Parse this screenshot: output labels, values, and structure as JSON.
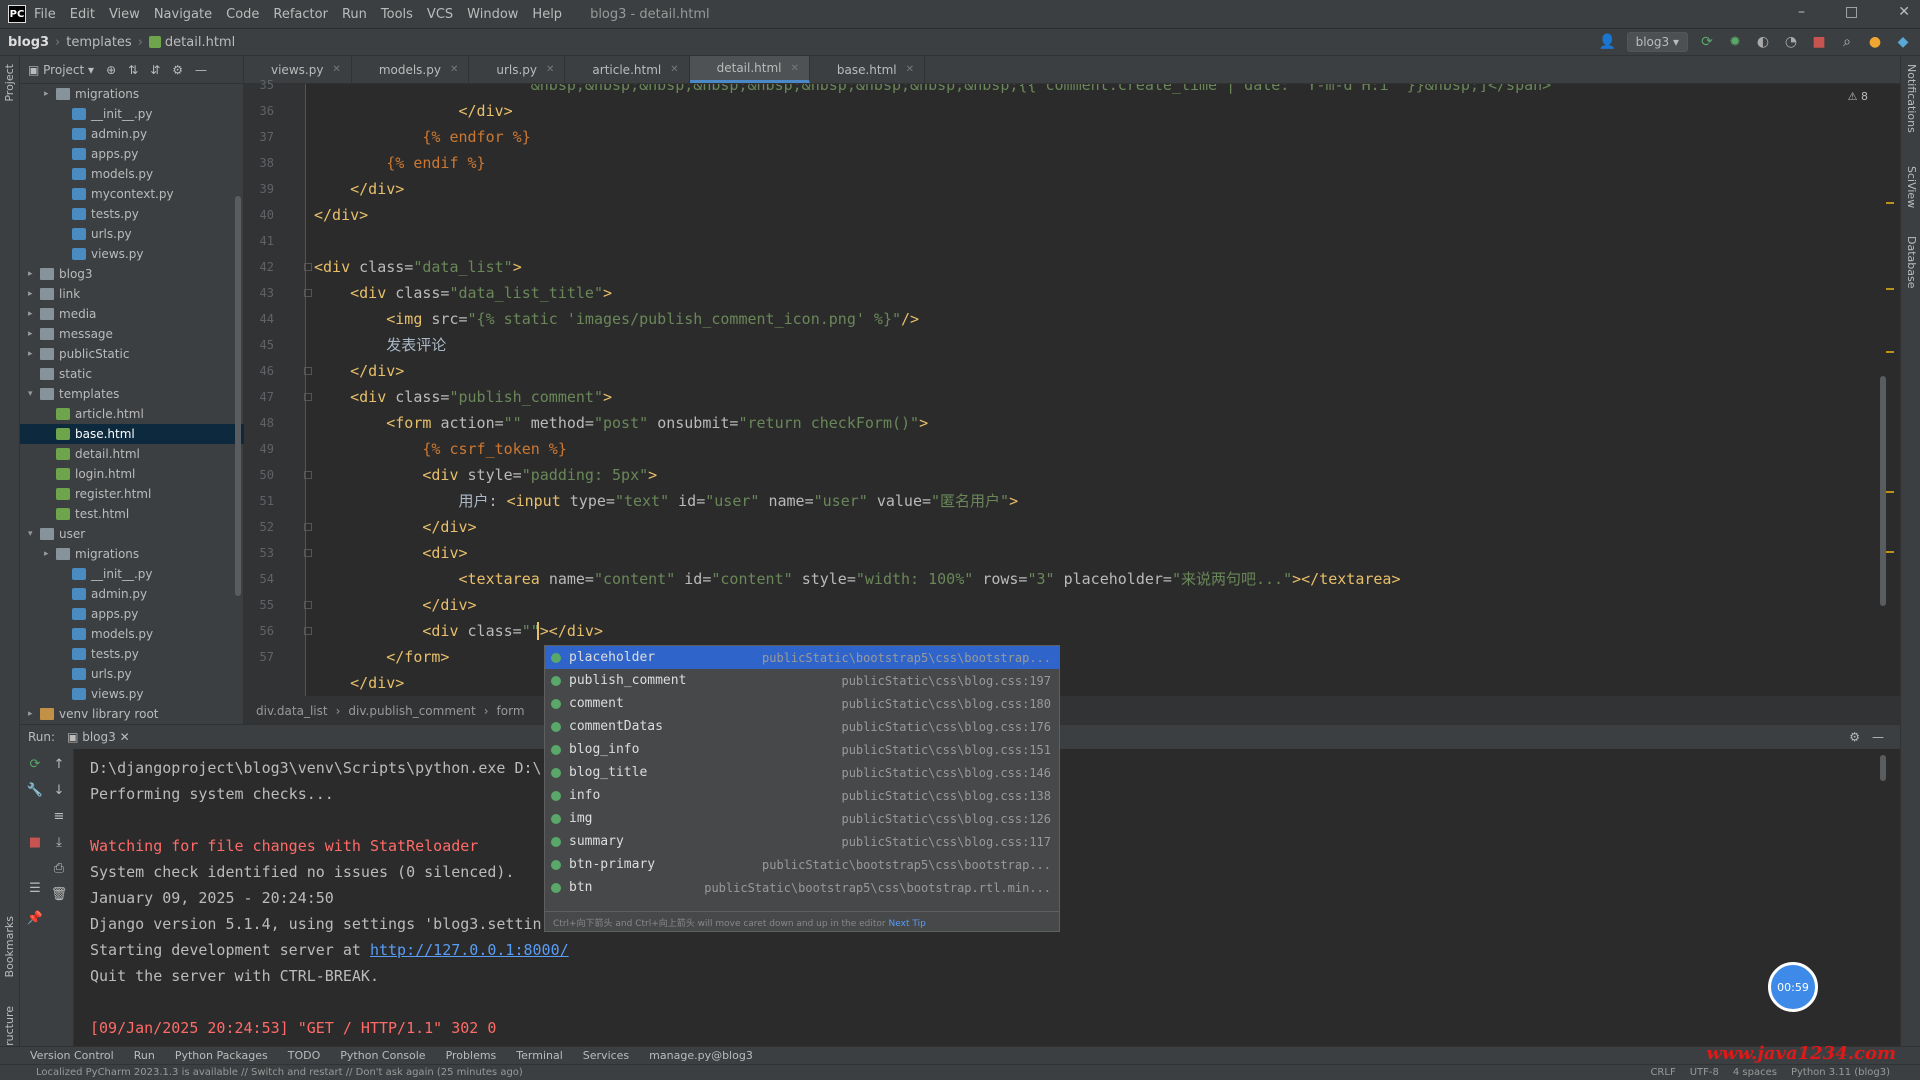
{
  "window": {
    "title": "blog3 - detail.html",
    "menu": [
      "File",
      "Edit",
      "View",
      "Navigate",
      "Code",
      "Refactor",
      "Run",
      "Tools",
      "VCS",
      "Window",
      "Help"
    ],
    "controls": [
      "–",
      "□",
      "✕"
    ]
  },
  "navbar": {
    "crumbs": [
      "blog3",
      "templates",
      "detail.html"
    ],
    "run_config": "blog3"
  },
  "project_panel": {
    "title": "Project",
    "tree": [
      {
        "label": "migrations",
        "type": "folder",
        "depth": 2,
        "arrow": "▸"
      },
      {
        "label": "__init__.py",
        "type": "py",
        "depth": 3
      },
      {
        "label": "admin.py",
        "type": "py",
        "depth": 3
      },
      {
        "label": "apps.py",
        "type": "py",
        "depth": 3
      },
      {
        "label": "models.py",
        "type": "py",
        "depth": 3
      },
      {
        "label": "mycontext.py",
        "type": "py",
        "depth": 3
      },
      {
        "label": "tests.py",
        "type": "py",
        "depth": 3
      },
      {
        "label": "urls.py",
        "type": "py",
        "depth": 3
      },
      {
        "label": "views.py",
        "type": "py",
        "depth": 3
      },
      {
        "label": "blog3",
        "type": "folder",
        "depth": 1,
        "arrow": "▸"
      },
      {
        "label": "link",
        "type": "folder",
        "depth": 1,
        "arrow": "▸"
      },
      {
        "label": "media",
        "type": "folder",
        "depth": 1,
        "arrow": "▸"
      },
      {
        "label": "message",
        "type": "folder",
        "depth": 1,
        "arrow": "▸"
      },
      {
        "label": "publicStatic",
        "type": "folder",
        "depth": 1,
        "arrow": "▸"
      },
      {
        "label": "static",
        "type": "folder",
        "depth": 1
      },
      {
        "label": "templates",
        "type": "folder",
        "depth": 1,
        "arrow": "▾"
      },
      {
        "label": "article.html",
        "type": "html",
        "depth": 2
      },
      {
        "label": "base.html",
        "type": "html",
        "depth": 2,
        "selected": true
      },
      {
        "label": "detail.html",
        "type": "html",
        "depth": 2
      },
      {
        "label": "login.html",
        "type": "html",
        "depth": 2
      },
      {
        "label": "register.html",
        "type": "html",
        "depth": 2
      },
      {
        "label": "test.html",
        "type": "html",
        "depth": 2
      },
      {
        "label": "user",
        "type": "folder",
        "depth": 1,
        "arrow": "▾"
      },
      {
        "label": "migrations",
        "type": "folder",
        "depth": 2,
        "arrow": "▸"
      },
      {
        "label": "__init__.py",
        "type": "py",
        "depth": 3
      },
      {
        "label": "admin.py",
        "type": "py",
        "depth": 3
      },
      {
        "label": "apps.py",
        "type": "py",
        "depth": 3
      },
      {
        "label": "models.py",
        "type": "py",
        "depth": 3
      },
      {
        "label": "tests.py",
        "type": "py",
        "depth": 3
      },
      {
        "label": "urls.py",
        "type": "py",
        "depth": 3
      },
      {
        "label": "views.py",
        "type": "py",
        "depth": 3
      },
      {
        "label": "venv  library root",
        "type": "venv",
        "depth": 1,
        "arrow": "▸"
      }
    ]
  },
  "tabs": [
    {
      "label": "views.py",
      "type": "py"
    },
    {
      "label": "models.py",
      "type": "py"
    },
    {
      "label": "urls.py",
      "type": "py"
    },
    {
      "label": "article.html",
      "type": "html"
    },
    {
      "label": "detail.html",
      "type": "html",
      "active": true
    },
    {
      "label": "base.html",
      "type": "html"
    }
  ],
  "editor": {
    "inspection": "⚠ 8",
    "line_numbers": [
      "35",
      "36",
      "37",
      "38",
      "39",
      "40",
      "41",
      "42",
      "43",
      "44",
      "45",
      "46",
      "47",
      "48",
      "49",
      "50",
      "51",
      "52",
      "53",
      "54",
      "55",
      "56",
      "57"
    ],
    "lines": [
      [
        {
          "t": "                        &nbsp;&nbsp;&nbsp;&nbsp;&nbsp;&nbsp;&nbsp;&nbsp;&nbsp;{{ comment.create_time | date: 'Y-m-d H:i' }}&nbsp;]</span>",
          "c": "str"
        }
      ],
      [
        {
          "t": "                </div>",
          "c": "tag"
        }
      ],
      [
        {
          "t": "            ",
          "c": "txt"
        },
        {
          "t": "{% endfor %}",
          "c": "tpl"
        }
      ],
      [
        {
          "t": "        ",
          "c": "txt"
        },
        {
          "t": "{% endif %}",
          "c": "tpl"
        }
      ],
      [
        {
          "t": "    </div>",
          "c": "tag"
        }
      ],
      [
        {
          "t": "</div>",
          "c": "tag"
        }
      ],
      [
        {
          "t": "",
          "c": "txt"
        }
      ],
      [
        {
          "t": "<div ",
          "c": "tag"
        },
        {
          "t": "class=",
          "c": "atr"
        },
        {
          "t": "\"data_list\"",
          "c": "str"
        },
        {
          "t": ">",
          "c": "tag"
        }
      ],
      [
        {
          "t": "    <div ",
          "c": "tag"
        },
        {
          "t": "class=",
          "c": "atr"
        },
        {
          "t": "\"data_list_title\"",
          "c": "str"
        },
        {
          "t": ">",
          "c": "tag"
        }
      ],
      [
        {
          "t": "        <img ",
          "c": "tag"
        },
        {
          "t": "src=",
          "c": "atr"
        },
        {
          "t": "\"{% static 'images/publish_comment_icon.png' %}\"",
          "c": "str"
        },
        {
          "t": "/>",
          "c": "tag"
        }
      ],
      [
        {
          "t": "        发表评论",
          "c": "txt"
        }
      ],
      [
        {
          "t": "    </div>",
          "c": "tag"
        }
      ],
      [
        {
          "t": "    <div ",
          "c": "tag"
        },
        {
          "t": "class=",
          "c": "atr"
        },
        {
          "t": "\"publish_comment\"",
          "c": "str"
        },
        {
          "t": ">",
          "c": "tag"
        }
      ],
      [
        {
          "t": "        <form ",
          "c": "tag"
        },
        {
          "t": "action=",
          "c": "atr"
        },
        {
          "t": "\"\" ",
          "c": "str"
        },
        {
          "t": "method=",
          "c": "atr"
        },
        {
          "t": "\"post\" ",
          "c": "str"
        },
        {
          "t": "onsubmit=",
          "c": "atr"
        },
        {
          "t": "\"return checkForm()\"",
          "c": "str"
        },
        {
          "t": ">",
          "c": "tag"
        }
      ],
      [
        {
          "t": "            ",
          "c": "txt"
        },
        {
          "t": "{% csrf_token %}",
          "c": "tpl"
        }
      ],
      [
        {
          "t": "            <div ",
          "c": "tag"
        },
        {
          "t": "style=",
          "c": "atr"
        },
        {
          "t": "\"padding: 5px\"",
          "c": "str"
        },
        {
          "t": ">",
          "c": "tag"
        }
      ],
      [
        {
          "t": "                用户: ",
          "c": "txt"
        },
        {
          "t": "<input ",
          "c": "tag"
        },
        {
          "t": "type=",
          "c": "atr"
        },
        {
          "t": "\"text\" ",
          "c": "str"
        },
        {
          "t": "id=",
          "c": "atr"
        },
        {
          "t": "\"user\" ",
          "c": "str"
        },
        {
          "t": "name=",
          "c": "atr"
        },
        {
          "t": "\"user\" ",
          "c": "str"
        },
        {
          "t": "value=",
          "c": "atr"
        },
        {
          "t": "\"匿名用户\"",
          "c": "str"
        },
        {
          "t": ">",
          "c": "tag"
        }
      ],
      [
        {
          "t": "            </div>",
          "c": "tag"
        }
      ],
      [
        {
          "t": "            <div>",
          "c": "tag"
        }
      ],
      [
        {
          "t": "                <textarea ",
          "c": "tag"
        },
        {
          "t": "name=",
          "c": "atr"
        },
        {
          "t": "\"content\" ",
          "c": "str"
        },
        {
          "t": "id=",
          "c": "atr"
        },
        {
          "t": "\"content\" ",
          "c": "str"
        },
        {
          "t": "style=",
          "c": "atr"
        },
        {
          "t": "\"width: 100%\" ",
          "c": "str"
        },
        {
          "t": "rows=",
          "c": "atr"
        },
        {
          "t": "\"3\" ",
          "c": "str"
        },
        {
          "t": "placeholder=",
          "c": "atr"
        },
        {
          "t": "\"来说两句吧...\"",
          "c": "str"
        },
        {
          "t": "></textarea>",
          "c": "tag"
        }
      ],
      [
        {
          "t": "            </div>",
          "c": "tag"
        }
      ],
      [
        {
          "t": "            <div ",
          "c": "tag"
        },
        {
          "t": "class=",
          "c": "atr"
        },
        {
          "t": "\"\"",
          "c": "str"
        },
        {
          "t": "></div>",
          "c": "tag"
        }
      ],
      [
        {
          "t": "        </form>",
          "c": "tag"
        }
      ],
      [
        {
          "t": "    </div>",
          "c": "tag"
        }
      ]
    ],
    "breadcrumb": [
      "div.data_list",
      "div.publish_comment",
      "form"
    ]
  },
  "autocomplete": {
    "items": [
      {
        "name": "placeholder",
        "source": "publicStatic\\bootstrap5\\css\\bootstrap...",
        "selected": true
      },
      {
        "name": "publish_comment",
        "source": "publicStatic\\css\\blog.css:197"
      },
      {
        "name": "comment",
        "source": "publicStatic\\css\\blog.css:180"
      },
      {
        "name": "commentDatas",
        "source": "publicStatic\\css\\blog.css:176"
      },
      {
        "name": "blog_info",
        "source": "publicStatic\\css\\blog.css:151"
      },
      {
        "name": "blog_title",
        "source": "publicStatic\\css\\blog.css:146"
      },
      {
        "name": "info",
        "source": "publicStatic\\css\\blog.css:138"
      },
      {
        "name": "img",
        "source": "publicStatic\\css\\blog.css:126"
      },
      {
        "name": "summary",
        "source": "publicStatic\\css\\blog.css:117"
      },
      {
        "name": "btn-primary",
        "source": "publicStatic\\bootstrap5\\css\\bootstrap..."
      },
      {
        "name": "btn",
        "source": "publicStatic\\bootstrap5\\css\\bootstrap.rtl.min..."
      }
    ],
    "footer": "Ctrl+向下箭头 and Ctrl+向上箭头 will move caret down and up in the editor",
    "footer_link": "Next Tip"
  },
  "run_panel": {
    "label": "Run:",
    "tab": "blog3",
    "lines": [
      {
        "text": "D:\\djangoproject\\blog3\\venv\\Scripts\\python.exe D:\\",
        "style": "norm"
      },
      {
        "text": "Performing system checks...",
        "style": "norm"
      },
      {
        "text": "",
        "style": "norm"
      },
      {
        "text": "Watching for file changes with StatReloader",
        "style": "red"
      },
      {
        "text": "System check identified no issues (0 silenced).",
        "style": "norm"
      },
      {
        "text": "January 09, 2025 - 20:24:50",
        "style": "norm"
      },
      {
        "text": "Django version 5.1.4, using settings 'blog3.settin",
        "style": "norm"
      },
      {
        "text": "Starting development server at ",
        "style": "norm",
        "link": "http://127.0.0.1:8000/"
      },
      {
        "text": "Quit the server with CTRL-BREAK.",
        "style": "norm"
      },
      {
        "text": "",
        "style": "norm"
      },
      {
        "text": "[09/Jan/2025 20:24:53] \"GET / HTTP/1.1\" 302 0",
        "style": "red"
      }
    ],
    "timer": "00:59"
  },
  "toolwindows": [
    "Version Control",
    "Run",
    "Python Packages",
    "TODO",
    "Python Console",
    "Problems",
    "Terminal",
    "Services",
    "manage.py@blog3"
  ],
  "status": {
    "message": "Localized PyCharm 2023.1.3 is available // Switch and restart // Don't ask again (25 minutes ago)",
    "right": [
      "CRLF",
      "UTF-8",
      "4 spaces",
      "Python 3.11 (blog3)"
    ]
  },
  "side_labels": {
    "left": [
      "Project",
      "Bookmarks",
      "Structure"
    ],
    "right": [
      "Notifications",
      "SciView",
      "Database"
    ]
  },
  "watermark": "www.java1234.com"
}
